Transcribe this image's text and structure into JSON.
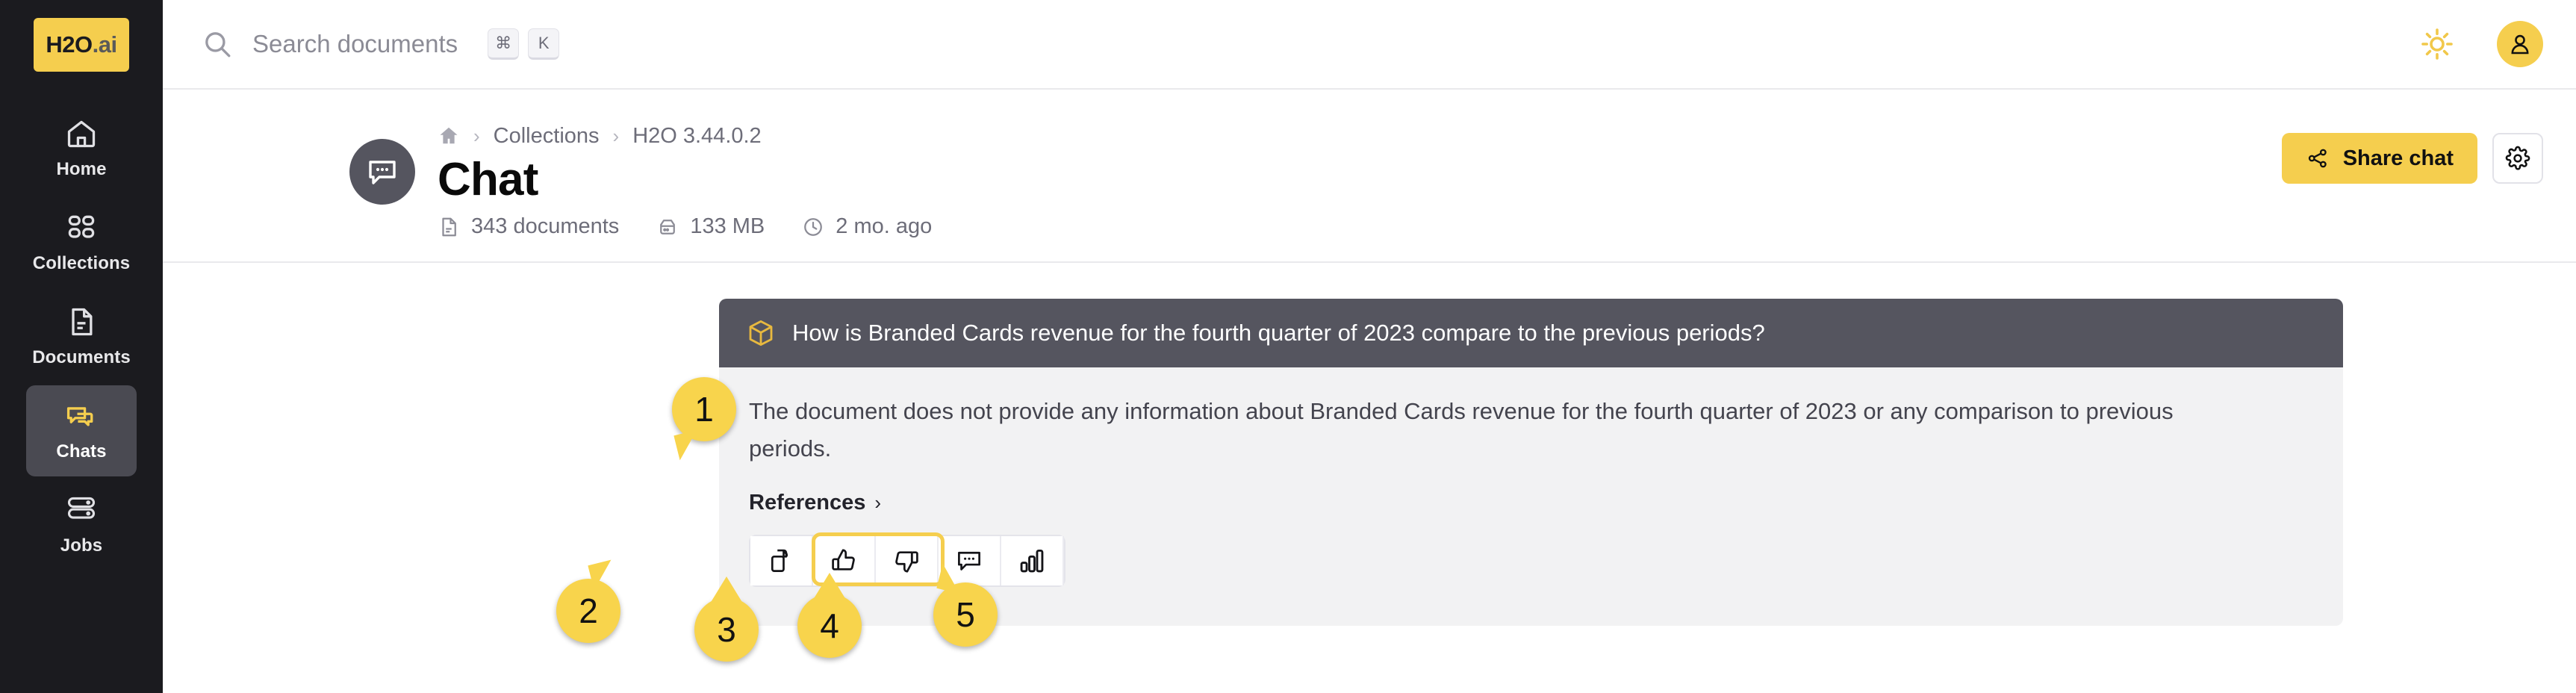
{
  "sidebar": {
    "logo": {
      "main": "H2O",
      "suffix": ".ai",
      "name": "h2o-ai-logo"
    },
    "items": [
      {
        "label": "Home",
        "icon": "home-icon",
        "active": false
      },
      {
        "label": "Collections",
        "icon": "collections-icon",
        "active": false
      },
      {
        "label": "Documents",
        "icon": "documents-icon",
        "active": false
      },
      {
        "label": "Chats",
        "icon": "chats-icon",
        "active": true
      },
      {
        "label": "Jobs",
        "icon": "jobs-icon",
        "active": false
      }
    ]
  },
  "topbar": {
    "search": {
      "placeholder": "Search documents",
      "icon": "search-icon",
      "shortcut_keys": [
        "⌘",
        "K"
      ]
    },
    "theme_toggle_icon": "sun-icon",
    "avatar_icon": "user-avatar-icon"
  },
  "pagehead": {
    "breadcrumb": {
      "home_icon": "home-icon",
      "separator": "›",
      "items": [
        "Collections",
        "H2O 3.44.0.2"
      ]
    },
    "title": "Chat",
    "chat_avatar_icon": "chat-bubble-icon",
    "meta": [
      {
        "icon": "document-icon",
        "text": "343 documents"
      },
      {
        "icon": "storage-icon",
        "text": "133 MB"
      },
      {
        "icon": "clock-icon",
        "text": "2 mo. ago"
      }
    ],
    "share_button": {
      "label": "Share chat",
      "icon": "share-icon"
    },
    "settings_button": {
      "icon": "gear-icon"
    }
  },
  "conversation": {
    "question": {
      "icon": "cube-icon",
      "text": "How is Branded Cards revenue for the fourth quarter of 2023 compare to the previous periods?"
    },
    "answer": {
      "text": "The document does not provide any information about Branded Cards revenue for the fourth quarter of 2023 or any comparison to previous periods.",
      "references_label": "References",
      "references_chevron": "›"
    },
    "toolbar": [
      {
        "name": "copy-button",
        "icon": "copy-icon"
      },
      {
        "name": "thumbs-up-button",
        "icon": "thumbs-up-icon"
      },
      {
        "name": "thumbs-down-button",
        "icon": "thumbs-down-icon"
      },
      {
        "name": "comment-button",
        "icon": "comment-icon"
      },
      {
        "name": "chart-button",
        "icon": "bar-chart-icon"
      }
    ]
  },
  "annotations": {
    "badges": [
      {
        "id": "1",
        "label": "1"
      },
      {
        "id": "2",
        "label": "2"
      },
      {
        "id": "3",
        "label": "3"
      },
      {
        "id": "4",
        "label": "4"
      },
      {
        "id": "5",
        "label": "5"
      }
    ]
  },
  "colors": {
    "brand_yellow": "#f5ce4e",
    "sidebar_bg": "#1b1b1f",
    "question_bar": "#55555f",
    "answer_bg": "#f2f2f3",
    "annotation_badge": "#f8d44c"
  }
}
